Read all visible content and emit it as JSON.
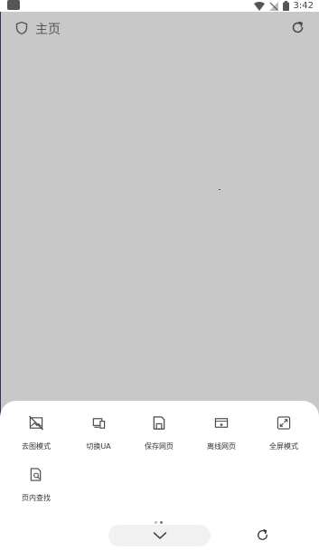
{
  "status_bar": {
    "time": "3:42"
  },
  "address_bar": {
    "title": "主页"
  },
  "menu": {
    "items": [
      {
        "id": "no-image",
        "label": "去图模式",
        "icon": "no-image-icon"
      },
      {
        "id": "switch-ua",
        "label": "切换UA",
        "icon": "switch-ua-icon"
      },
      {
        "id": "save-page",
        "label": "保存网页",
        "icon": "save-page-icon"
      },
      {
        "id": "offline-page",
        "label": "离线网页",
        "icon": "offline-page-icon"
      },
      {
        "id": "fullscreen",
        "label": "全屏模式",
        "icon": "fullscreen-icon"
      },
      {
        "id": "find-in-page",
        "label": "页内查找",
        "icon": "find-in-page-icon"
      }
    ],
    "pages": 2,
    "active_page": 2
  },
  "colors": {
    "scrim": "#c8c8c8",
    "sheet": "#ffffff",
    "pill": "#f1f1f1"
  }
}
